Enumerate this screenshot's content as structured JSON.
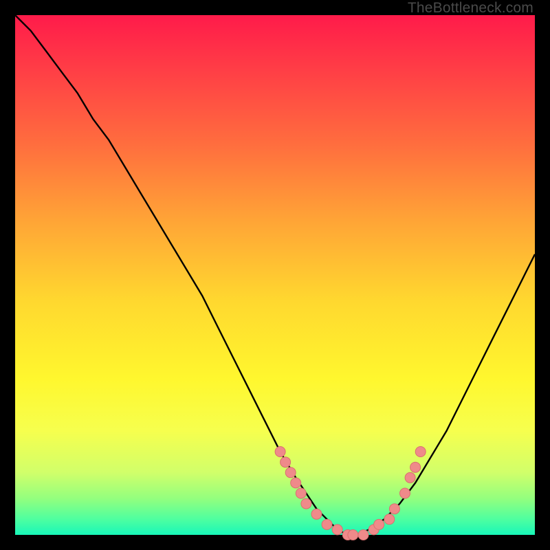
{
  "watermark": "TheBottleneck.com",
  "colors": {
    "curve": "#000000",
    "marker_fill": "#ef8a8a",
    "marker_stroke": "#d96f6f",
    "gradient_top": "#ff1b4a",
    "gradient_bottom": "#18f7b9",
    "frame": "#000000"
  },
  "chart_data": {
    "type": "line",
    "title": "",
    "xlabel": "",
    "ylabel": "",
    "xlim": [
      0,
      100
    ],
    "ylim": [
      0,
      100
    ],
    "curve": {
      "x": [
        0,
        3,
        6,
        9,
        12,
        15,
        18,
        21,
        24,
        27,
        30,
        33,
        36,
        39,
        42,
        45,
        48,
        51,
        54,
        56,
        58,
        60,
        62,
        64,
        66,
        68,
        71,
        74,
        77,
        80,
        83,
        86,
        89,
        92,
        95,
        98,
        100
      ],
      "y": [
        100,
        97,
        93,
        89,
        85,
        80,
        76,
        71,
        66,
        61,
        56,
        51,
        46,
        40,
        34,
        28,
        22,
        16,
        11,
        8,
        5,
        3,
        1,
        0,
        0,
        1,
        3,
        6,
        10,
        15,
        20,
        26,
        32,
        38,
        44,
        50,
        54
      ]
    },
    "markers": [
      {
        "x": 51,
        "y": 16
      },
      {
        "x": 52,
        "y": 14
      },
      {
        "x": 53,
        "y": 12
      },
      {
        "x": 54,
        "y": 10
      },
      {
        "x": 55,
        "y": 8
      },
      {
        "x": 56,
        "y": 6
      },
      {
        "x": 58,
        "y": 4
      },
      {
        "x": 60,
        "y": 2
      },
      {
        "x": 62,
        "y": 1
      },
      {
        "x": 64,
        "y": 0
      },
      {
        "x": 65,
        "y": 0
      },
      {
        "x": 67,
        "y": 0
      },
      {
        "x": 69,
        "y": 1
      },
      {
        "x": 70,
        "y": 2
      },
      {
        "x": 72,
        "y": 3
      },
      {
        "x": 73,
        "y": 5
      },
      {
        "x": 75,
        "y": 8
      },
      {
        "x": 76,
        "y": 11
      },
      {
        "x": 77,
        "y": 13
      },
      {
        "x": 78,
        "y": 16
      }
    ]
  }
}
